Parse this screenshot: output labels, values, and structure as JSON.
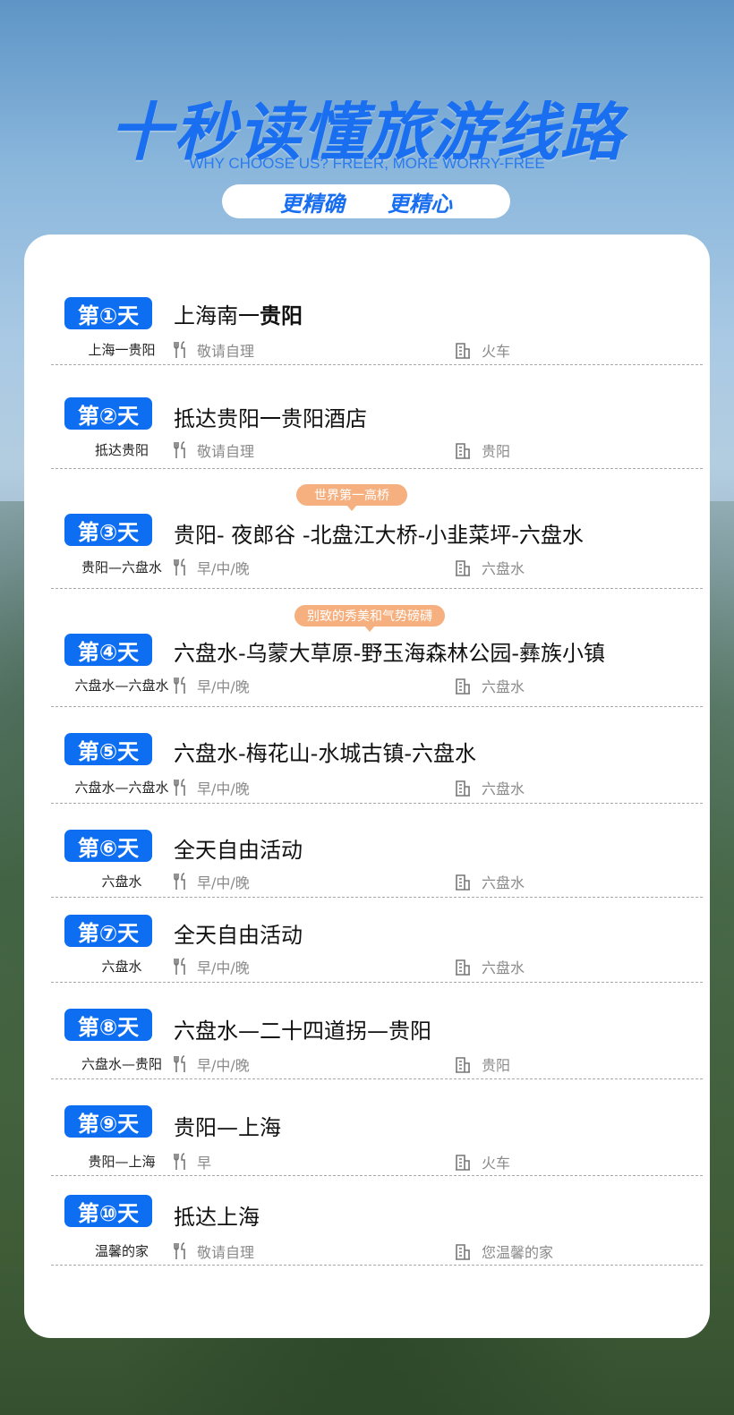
{
  "header": {
    "title": "十秒读懂旅游线路",
    "subtitle": "WHY CHOOSE US? FREER, MORE WORRY-FREE",
    "pill_left": "更精确",
    "pill_right": "更精心"
  },
  "colors": {
    "accent": "#0e6ef2",
    "tag": "#f6b07f"
  },
  "days": [
    {
      "badge": "第①天",
      "route": "上海一贵阳",
      "title_prefix": "上海南一",
      "title_bold": "贵阳",
      "meal": "敬请自理",
      "stay": "火车"
    },
    {
      "badge": "第②天",
      "route": "抵达贵阳",
      "title": "抵达贵阳一贵阳酒店",
      "meal": "敬请自理",
      "stay": "贵阳"
    },
    {
      "badge": "第③天",
      "route": "贵阳—六盘水",
      "title": "贵阳-  夜郎谷  -北盘江大桥-小韭菜坪-六盘水",
      "tag": "世界第一高桥",
      "meal": "早/中/晚",
      "stay": "六盘水"
    },
    {
      "badge": "第④天",
      "route": "六盘水—六盘水",
      "title": "六盘水-乌蒙大草原-野玉海森林公园-彝族小镇",
      "tag": "别致的秀美和气势磅礴",
      "meal": "早/中/晚",
      "stay": "六盘水"
    },
    {
      "badge": "第⑤天",
      "route": "六盘水—六盘水",
      "title": "六盘水-梅花山-水城古镇-六盘水",
      "meal": "早/中/晚",
      "stay": "六盘水"
    },
    {
      "badge": "第⑥天",
      "route": "六盘水",
      "title": "全天自由活动",
      "meal": "早/中/晚",
      "stay": "六盘水"
    },
    {
      "badge": "第⑦天",
      "route": "六盘水",
      "title": "全天自由活动",
      "meal": "早/中/晚",
      "stay": "六盘水"
    },
    {
      "badge": "第⑧天",
      "route": "六盘水—贵阳",
      "title": "六盘水—二十四道拐—贵阳",
      "meal": "早/中/晚",
      "stay": "贵阳"
    },
    {
      "badge": "第⑨天",
      "route": "贵阳—上海",
      "title": "贵阳—上海",
      "meal": "早",
      "stay": "火车"
    },
    {
      "badge": "第⑩天",
      "route": "温馨的家",
      "title": "抵达上海",
      "meal": "敬请自理",
      "stay": "您温馨的家"
    }
  ]
}
